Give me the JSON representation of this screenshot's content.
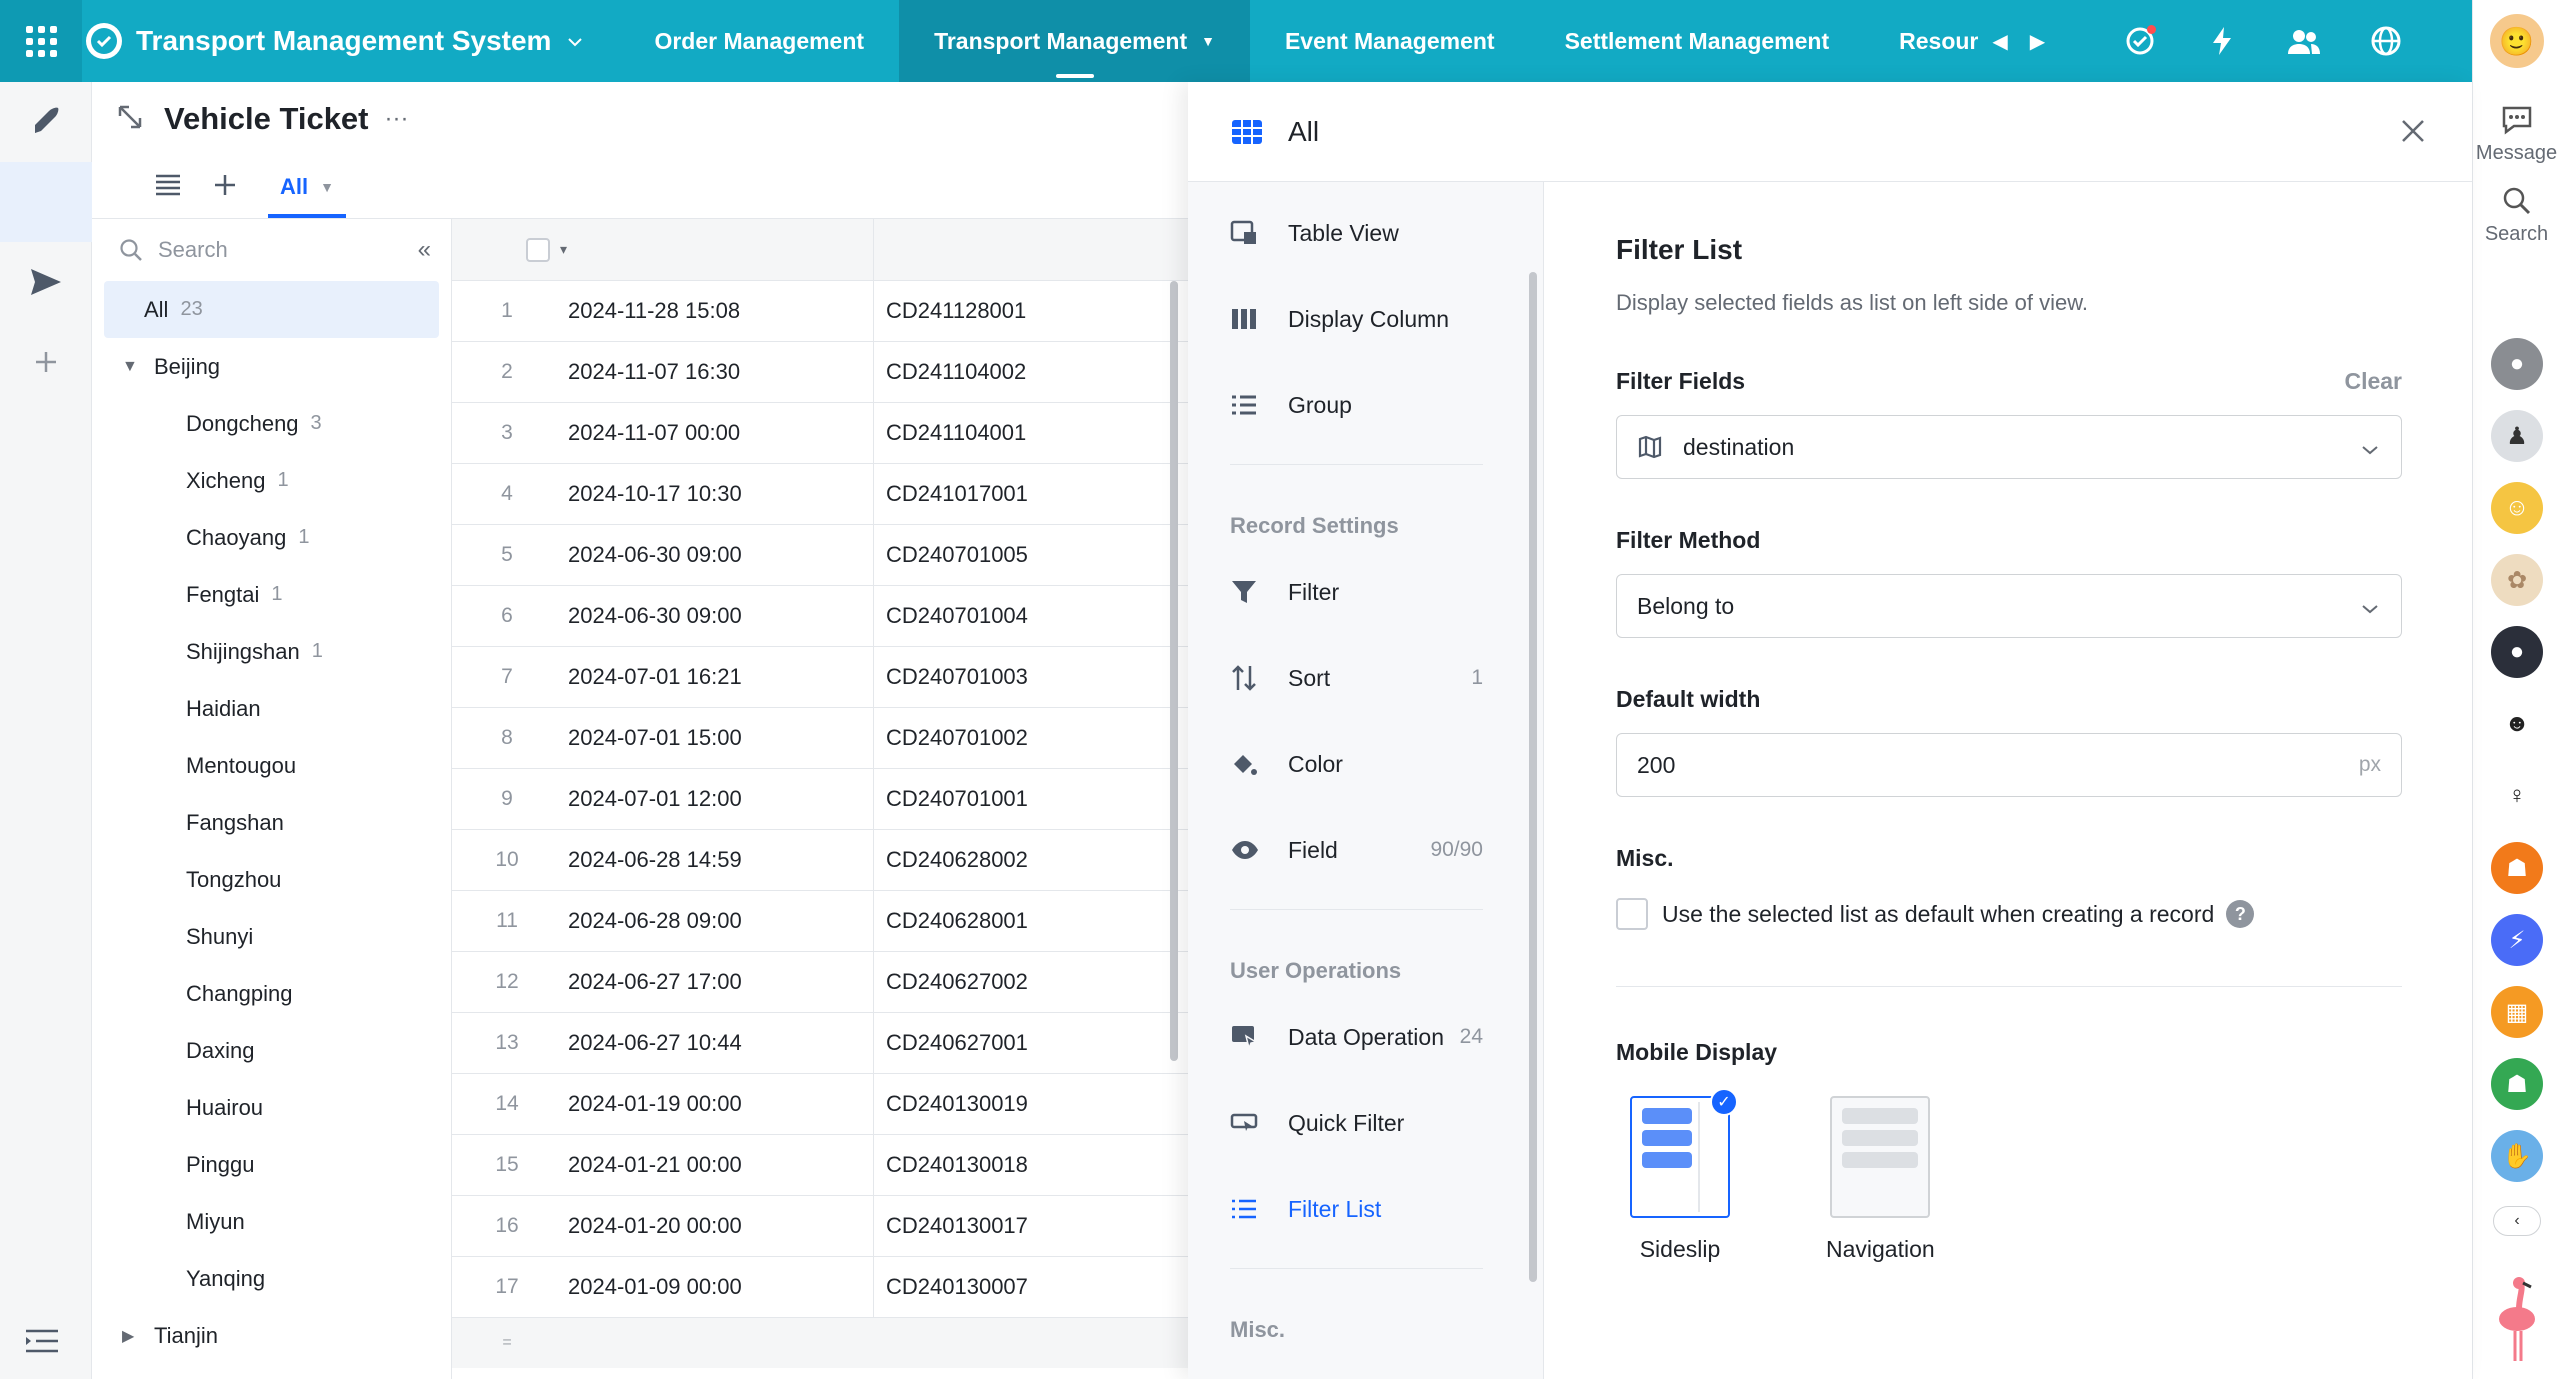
{
  "app": {
    "title": "Transport Management System"
  },
  "nav": {
    "items": [
      {
        "label": "Order Management",
        "active": false
      },
      {
        "label": "Transport Management",
        "active": true
      },
      {
        "label": "Event Management",
        "active": false
      },
      {
        "label": "Settlement Management",
        "active": false
      },
      {
        "label": "Resour",
        "active": false
      }
    ]
  },
  "rail": {
    "message_label": "Message",
    "search_label": "Search"
  },
  "header": {
    "title": "Vehicle Ticket",
    "tab_all": "All"
  },
  "tree": {
    "search_placeholder": "Search",
    "all_label": "All",
    "all_count": "23",
    "groups": [
      {
        "label": "Beijing",
        "expanded": true,
        "children": [
          {
            "label": "Dongcheng",
            "count": "3"
          },
          {
            "label": "Xicheng",
            "count": "1"
          },
          {
            "label": "Chaoyang",
            "count": "1"
          },
          {
            "label": "Fengtai",
            "count": "1"
          },
          {
            "label": "Shijingshan",
            "count": "1"
          },
          {
            "label": "Haidian",
            "count": ""
          },
          {
            "label": "Mentougou",
            "count": ""
          },
          {
            "label": "Fangshan",
            "count": ""
          },
          {
            "label": "Tongzhou",
            "count": ""
          },
          {
            "label": "Shunyi",
            "count": ""
          },
          {
            "label": "Changping",
            "count": ""
          },
          {
            "label": "Daxing",
            "count": ""
          },
          {
            "label": "Huairou",
            "count": ""
          },
          {
            "label": "Pinggu",
            "count": ""
          },
          {
            "label": "Miyun",
            "count": ""
          },
          {
            "label": "Yanqing",
            "count": ""
          }
        ]
      },
      {
        "label": "Tianjin",
        "expanded": false,
        "children": []
      }
    ]
  },
  "table": {
    "rows": [
      {
        "n": "1",
        "date": "2024-11-28 15:08",
        "code": "CD241128001"
      },
      {
        "n": "2",
        "date": "2024-11-07 16:30",
        "code": "CD241104002"
      },
      {
        "n": "3",
        "date": "2024-11-07 00:00",
        "code": "CD241104001"
      },
      {
        "n": "4",
        "date": "2024-10-17 10:30",
        "code": "CD241017001"
      },
      {
        "n": "5",
        "date": "2024-06-30 09:00",
        "code": "CD240701005"
      },
      {
        "n": "6",
        "date": "2024-06-30 09:00",
        "code": "CD240701004"
      },
      {
        "n": "7",
        "date": "2024-07-01 16:21",
        "code": "CD240701003"
      },
      {
        "n": "8",
        "date": "2024-07-01 15:00",
        "code": "CD240701002"
      },
      {
        "n": "9",
        "date": "2024-07-01 12:00",
        "code": "CD240701001"
      },
      {
        "n": "10",
        "date": "2024-06-28 14:59",
        "code": "CD240628002"
      },
      {
        "n": "11",
        "date": "2024-06-28 09:00",
        "code": "CD240628001"
      },
      {
        "n": "12",
        "date": "2024-06-27 17:00",
        "code": "CD240627002"
      },
      {
        "n": "13",
        "date": "2024-06-27 10:44",
        "code": "CD240627001"
      },
      {
        "n": "14",
        "date": "2024-01-19 00:00",
        "code": "CD240130019"
      },
      {
        "n": "15",
        "date": "2024-01-21 00:00",
        "code": "CD240130018"
      },
      {
        "n": "16",
        "date": "2024-01-20 00:00",
        "code": "CD240130017"
      },
      {
        "n": "17",
        "date": "2024-01-09 00:00",
        "code": "CD240130007"
      }
    ],
    "footer_symbol": "="
  },
  "panel": {
    "title": "All",
    "nav": {
      "table_view": "Table View",
      "display_column": "Display Column",
      "group": "Group",
      "record_settings": "Record Settings",
      "filter": "Filter",
      "sort": "Sort",
      "sort_count": "1",
      "color": "Color",
      "field": "Field",
      "field_count": "90/90",
      "user_operations": "User Operations",
      "data_operation": "Data Operation",
      "data_operation_count": "24",
      "quick_filter": "Quick Filter",
      "filter_list": "Filter List",
      "misc": "Misc."
    },
    "body": {
      "title": "Filter List",
      "desc": "Display selected fields as list on left side of view.",
      "filter_fields_label": "Filter Fields",
      "clear_label": "Clear",
      "filter_field_value": "destination",
      "filter_method_label": "Filter Method",
      "filter_method_value": "Belong to",
      "default_width_label": "Default width",
      "default_width_value": "200",
      "default_width_unit": "px",
      "misc_label": "Misc.",
      "misc_checkbox_label": "Use the selected list as default when creating a record",
      "mobile_display_label": "Mobile Display",
      "mobile_options": [
        {
          "label": "Sideslip",
          "selected": true
        },
        {
          "label": "Navigation",
          "selected": false
        }
      ]
    }
  },
  "colors": {
    "topbar": "#12aac4",
    "accent": "#1664ff"
  }
}
